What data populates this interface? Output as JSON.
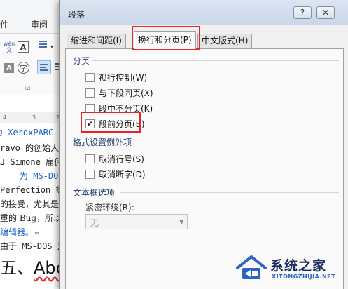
{
  "background": {
    "menu": [
      "件",
      "审阅"
    ],
    "ribbon": {
      "wen_glyph": "wén\n文",
      "a_box": "A",
      "a_gray": "A",
      "zi": "字"
    },
    "ruler": [
      "4",
      "3",
      "2"
    ],
    "doc_lines": [
      "为 XeroxPARC",
      "ravo 的创始人",
      "J Simone 雇佣",
      "为 MS-DOS",
      "Perfection 等",
      "的接受，尤其是",
      "重的 Bug，所以",
      "编辑器。↵",
      "由于 MS-DOS 是"
    ],
    "heading": {
      "prefix": "五、",
      "word": "Abo"
    }
  },
  "dialog": {
    "title": "段落",
    "help_label": "?",
    "close_label": "✕",
    "tabs": [
      {
        "label": "缩进和间距(I)",
        "active": false
      },
      {
        "label": "换行和分页(P)",
        "active": true
      },
      {
        "label": "中文版式(H)",
        "active": false
      }
    ],
    "pagination": {
      "title": "分页",
      "options": [
        {
          "label": "孤行控制(W)",
          "checked": false
        },
        {
          "label": "与下段同页(X)",
          "checked": false
        },
        {
          "label": "段中不分页(K)",
          "checked": false
        },
        {
          "label": "段前分页(B)",
          "checked": true
        }
      ]
    },
    "format_exceptions": {
      "title": "格式设置例外项",
      "options": [
        {
          "label": "取消行号(S)",
          "checked": false
        },
        {
          "label": "取消断字(D)",
          "checked": false
        }
      ]
    },
    "textbox": {
      "title": "文本框选项",
      "wrap_label": "紧密环绕(R):",
      "wrap_value": "无"
    }
  },
  "watermark": {
    "name": "系统之家",
    "url": "XITONGZHIJIA.NET"
  },
  "colors": {
    "highlight_red": "#e3262a",
    "link_blue": "#1f5fc5",
    "group_title": "#1e3a6e"
  }
}
